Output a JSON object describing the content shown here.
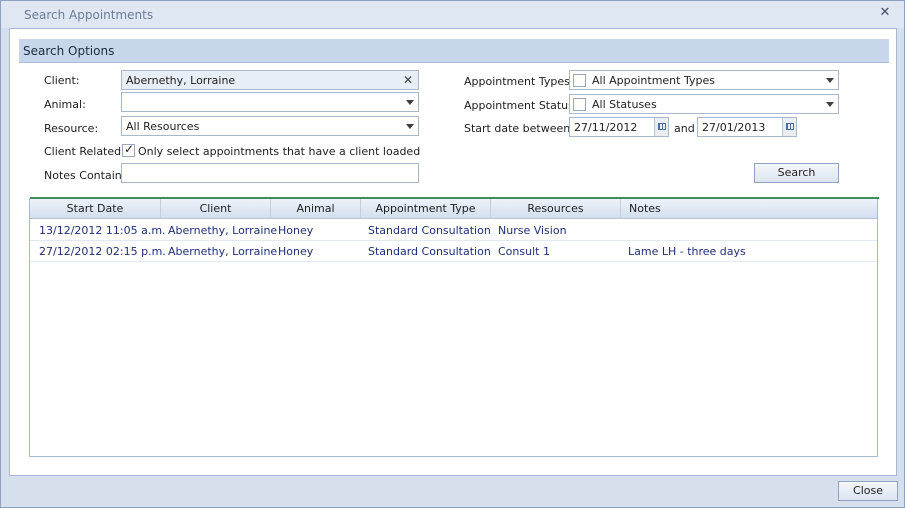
{
  "window": {
    "title": "Search Appointments"
  },
  "search_options": {
    "title": "Search Options",
    "client": {
      "label": "Client:",
      "value": "Abernethy, Lorraine"
    },
    "animal": {
      "label": "Animal:",
      "value": ""
    },
    "resource": {
      "label": "Resource:",
      "value": "All Resources"
    },
    "client_related": {
      "label": "Client Related:",
      "checked": true,
      "text": "Only select appointments that have a client loaded"
    },
    "notes_contain": {
      "label": "Notes Contain:",
      "value": ""
    },
    "appointment_types": {
      "label": "Appointment Types:",
      "value": "All Appointment Types"
    },
    "appointment_status": {
      "label": "Appointment Status:",
      "value": "All Statuses"
    },
    "start_date": {
      "label": "Start date between:",
      "from": "27/11/2012",
      "and_label": "and",
      "to": "27/01/2013"
    },
    "search_button": "Search"
  },
  "results": {
    "columns": [
      "Start Date",
      "Client",
      "Animal",
      "Appointment Type",
      "Resources",
      "Notes"
    ],
    "rows": [
      [
        "13/12/2012 11:05 a.m.",
        "Abernethy, Lorraine",
        "Honey",
        "Standard Consultation",
        "Nurse Vision",
        ""
      ],
      [
        "27/12/2012 02:15 p.m.",
        "Abernethy, Lorraine",
        "Honey",
        "Standard Consultation",
        "Consult 1",
        "Lame LH - three days"
      ]
    ]
  },
  "footer": {
    "close_button": "Close"
  },
  "colors": {
    "accent": "#3b8e5e",
    "header": "#c7d6eb",
    "link_text": "#1f2f78"
  }
}
